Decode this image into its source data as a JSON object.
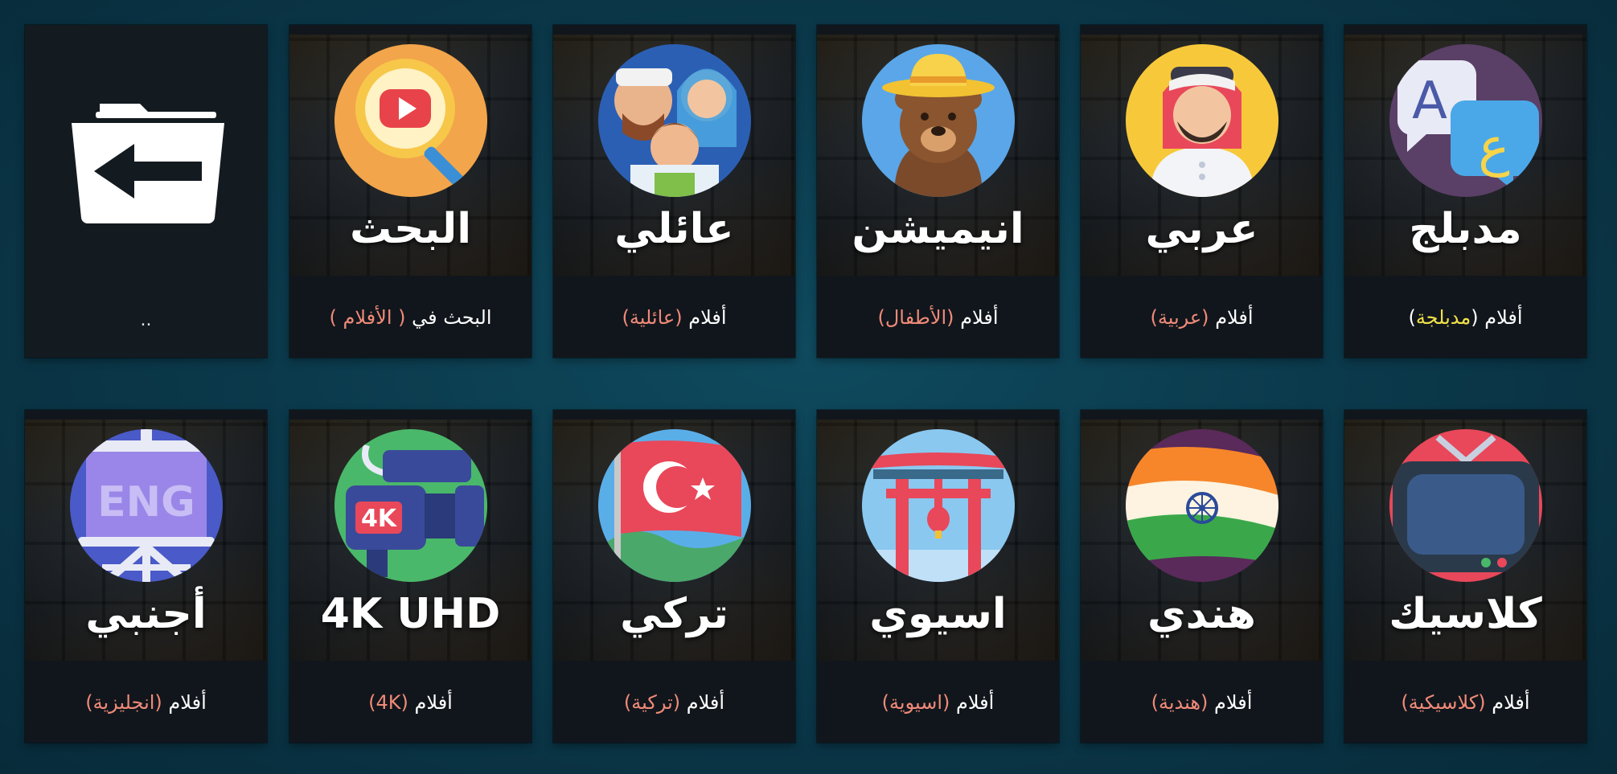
{
  "tiles": [
    {
      "id": "up",
      "caption": ".."
    },
    {
      "id": "search",
      "big": "البحث",
      "caption_pre": "البحث في",
      "caption_hl": "( الأفلام )"
    },
    {
      "id": "family",
      "big": "عائلي",
      "caption_pre": "أفلام",
      "caption_hl": "(عائلية)"
    },
    {
      "id": "animation",
      "big": "انيميشن",
      "caption_pre": "أفلام",
      "caption_hl": "(الأطفال)"
    },
    {
      "id": "arabic",
      "big": "عربي",
      "caption_pre": "أفلام",
      "caption_hl": "(عربية)"
    },
    {
      "id": "dubbed",
      "big": "مدبلج",
      "caption_pre": "أفلام (",
      "caption_hl": "مدبلجة",
      "caption_post": ")"
    },
    {
      "id": "foreign",
      "big": "أجنبي",
      "caption_pre": "أفلام",
      "caption_hl": "(انجليزية)",
      "badge": "ENG"
    },
    {
      "id": "uhd",
      "big": "4K UHD",
      "caption_pre": "أفلام",
      "caption_hl": "(4K)",
      "badge": "4K"
    },
    {
      "id": "turkish",
      "big": "تركي",
      "caption_pre": "أفلام",
      "caption_hl": "(تركية)"
    },
    {
      "id": "asian",
      "big": "اسيوي",
      "caption_pre": "أفلام",
      "caption_hl": "(اسيوية)"
    },
    {
      "id": "indian",
      "big": "هندي",
      "caption_pre": "أفلام",
      "caption_hl": "(هندية)"
    },
    {
      "id": "classic",
      "big": "كلاسيك",
      "caption_pre": "أفلام",
      "caption_hl": "(كلاسيكية)"
    }
  ],
  "icons": {
    "up": "folder-back-icon",
    "search": "youtube-search-icon",
    "family": "family-icon",
    "animation": "bear-cowboy-icon",
    "arabic": "arab-man-icon",
    "dubbed": "language-bubbles-icon",
    "foreign": "english-board-icon",
    "uhd": "4k-camera-icon",
    "turkish": "turkey-flag-icon",
    "asian": "torii-gate-icon",
    "indian": "india-flag-icon",
    "classic": "retro-tv-icon"
  },
  "colors": {
    "accent": "#f08a78",
    "dubbed_accent": "#f2e24b",
    "tile_bg": "#11161c",
    "background": "#0b3a4c"
  }
}
